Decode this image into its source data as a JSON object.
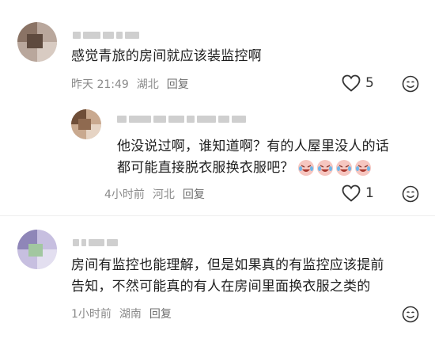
{
  "comments": [
    {
      "text": "感觉青旅的房间就应该装监控啊",
      "time": "昨天 21:49",
      "location": "湖北",
      "reply_label": "回复",
      "likes": "5"
    },
    {
      "line1": "他没说过啊，谁知道啊？有的人屋里没人的话",
      "line2": "都可能直接脱衣服换衣服吧？",
      "emoji_icon": "crying-laughing-face-icon",
      "time": "4小时前",
      "location": "河北",
      "reply_label": "回复",
      "likes": "1"
    },
    {
      "line1": "房间有监控也能理解，但是如果真的有监控应该提前",
      "line2": "告知，不然可能真的有人在房间里面换衣服之类的",
      "time": "1小时前",
      "location": "湖南",
      "reply_label": "回复"
    }
  ],
  "colors": {
    "text": "#1e1e1e",
    "meta": "#8a8a8a",
    "icon": "#333333"
  }
}
